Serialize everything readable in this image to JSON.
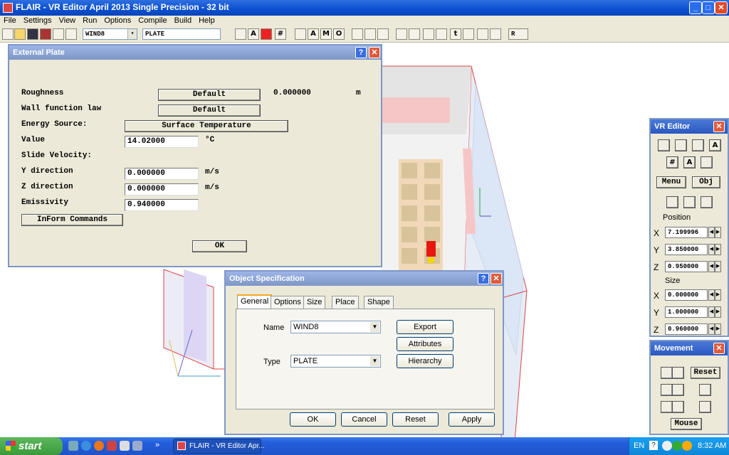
{
  "window": {
    "title": "FLAIR - VR Editor April 2013 Single Precision - 32 bit",
    "min_label": "_",
    "max_label": "□",
    "close_label": "✕"
  },
  "menu": [
    {
      "id": "file",
      "label": "File"
    },
    {
      "id": "settings",
      "label": "Settings"
    },
    {
      "id": "view",
      "label": "View"
    },
    {
      "id": "run",
      "label": "Run"
    },
    {
      "id": "options",
      "label": "Options"
    },
    {
      "id": "compile",
      "label": "Compile"
    },
    {
      "id": "build",
      "label": "Build"
    },
    {
      "id": "help",
      "label": "Help"
    }
  ],
  "toolbar": {
    "object_combo": "WIND8",
    "type_combo": "PLATE",
    "r_label": "R",
    "arrow_glyph": "▾",
    "glyphs": {
      "a_label": "A",
      "m_label": "M",
      "o_label": "O",
      "grid": "#",
      "t_label": "t"
    }
  },
  "external_plate": {
    "title": "External Plate",
    "help_label": "?",
    "close_label": "✕",
    "roughness_label": "Roughness",
    "roughness_button": "Default",
    "roughness_value": "0.000000",
    "roughness_unit": "m",
    "wall_function_label": "Wall function law",
    "wall_function_button": "Default",
    "energy_source_label": "Energy Source:",
    "energy_source_button": "Surface Temperature",
    "value_label": "Value",
    "value_field": "14.02000",
    "value_unit": "°C",
    "slide_velocity_label": "Slide Velocity:",
    "y_direction_label": "Y direction",
    "y_direction_value": "0.000000",
    "y_unit": "m/s",
    "z_direction_label": "Z direction",
    "z_direction_value": "0.000000",
    "z_unit": "m/s",
    "emissivity_label": "Emissivity",
    "emissivity_value": "0.940000",
    "inform_button": "InForm Commands",
    "ok_button": "OK"
  },
  "object_spec": {
    "title": "Object Specification",
    "help_label": "?",
    "close_label": "✕",
    "tabs": [
      "General",
      "Options",
      "Size",
      "Place",
      "Shape"
    ],
    "name_label": "Name",
    "name_value": "WIND8",
    "type_label": "Type",
    "type_value": "PLATE",
    "export_button": "Export",
    "attributes_button": "Attributes",
    "hierarchy_button": "Hierarchy",
    "ok_button": "OK",
    "cancel_button": "Cancel",
    "reset_button": "Reset",
    "apply_button": "Apply",
    "dropdown_arrow": "▼"
  },
  "vr_editor": {
    "title": "VR Editor",
    "close_label": "✕",
    "menu_button": "Menu",
    "obj_button": "Obj",
    "position_label": "Position",
    "size_label": "Size",
    "x_label": "X",
    "y_label": "Y",
    "z_label": "Z",
    "pos_x": "7.199996",
    "pos_y": "3.850000",
    "pos_z": "0.950000",
    "size_x": "0.000000",
    "size_y": "1.000000",
    "size_z": "0.960000",
    "spin_left": "◀",
    "spin_right": "▶",
    "glyphs": {
      "a": "A",
      "grid": "#"
    }
  },
  "movement": {
    "title": "Movement",
    "close_label": "✕",
    "reset_button": "Reset",
    "mouse_button": "Mouse"
  },
  "taskbar": {
    "start_label": "start",
    "chevron": "»",
    "task_item": "FLAIR - VR Editor Apr...",
    "language": "EN",
    "help_glyph": "?",
    "time": "8:32 AM"
  },
  "colors": {
    "title_blue": "#0a4fd0",
    "dialog_title": "#7d97c6",
    "face": "#ece9d8",
    "scene_red": "#e03030"
  }
}
